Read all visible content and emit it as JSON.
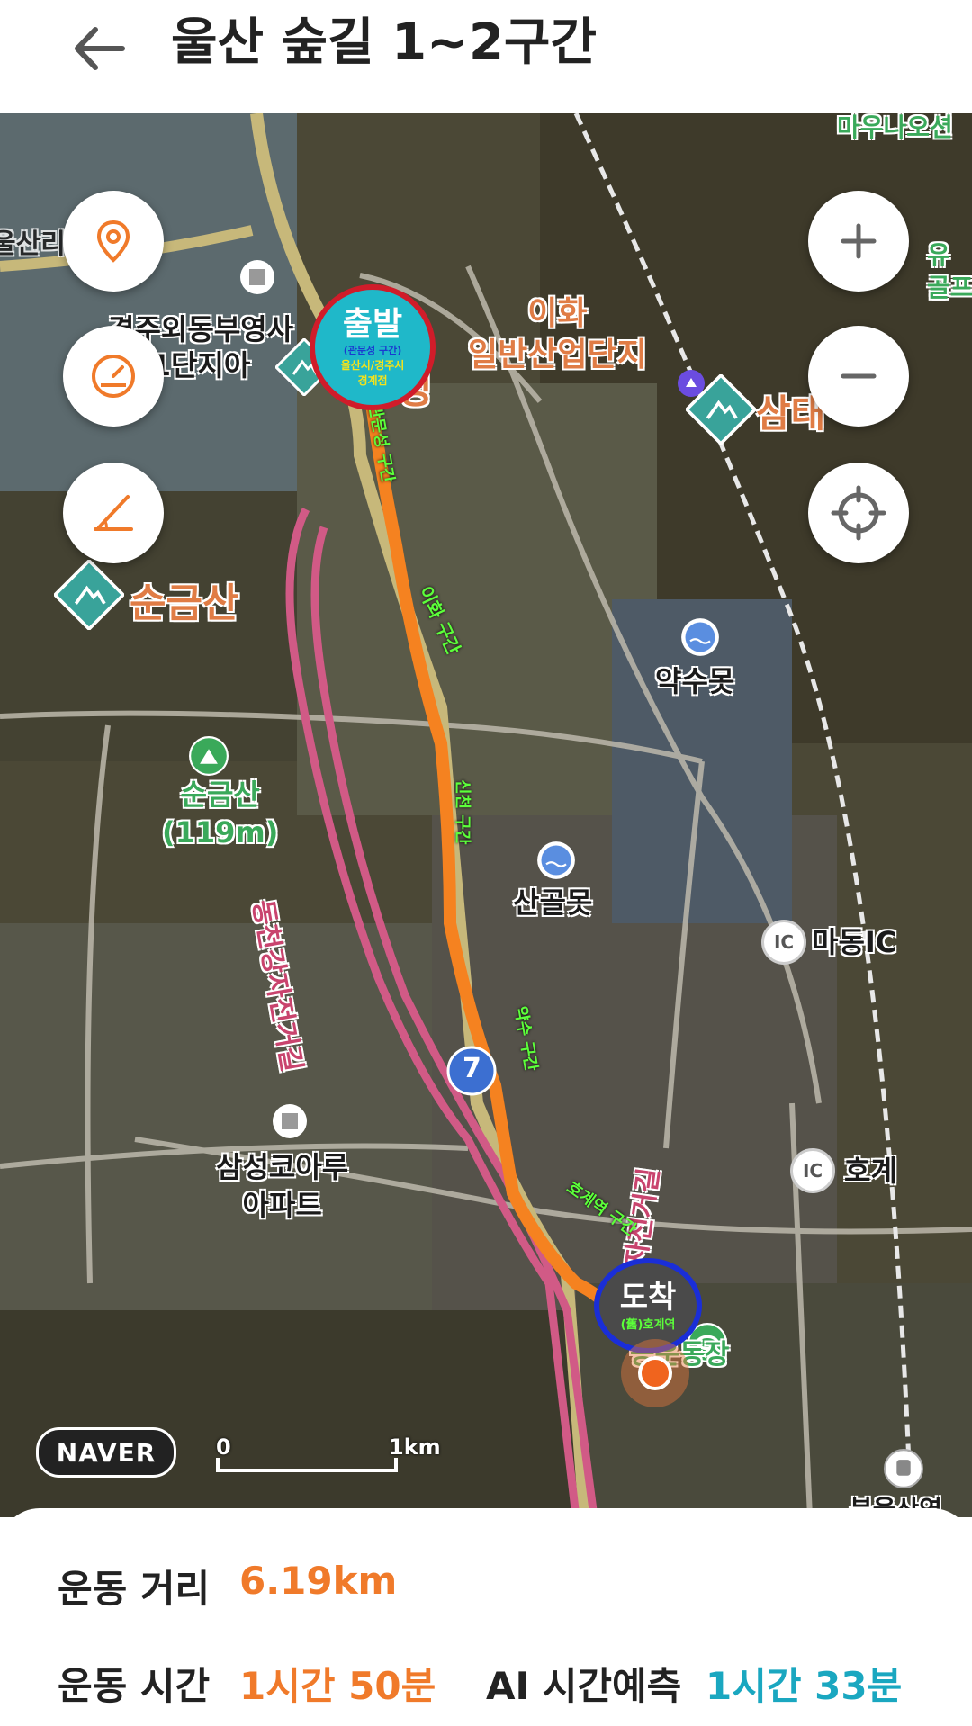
{
  "header": {
    "title": "울산 숲길 1~2구간"
  },
  "map": {
    "places": {
      "gyeongju_apt": "경주외동부영사\n1단지아",
      "ihwa_industrial": "이화\n일반산업단지",
      "samtae": "삼태",
      "sungeumsan": "순금산",
      "sungeumsan_peak": "순금산\n(119m)",
      "yaksumot": "약수못",
      "sangolmot": "산골못",
      "madong_ic": "마동IC",
      "hogye": "호계",
      "samsung_apt": "삼성코아루\n아파트",
      "sports_ground": "공운동장",
      "bike_road_1": "동천강자전거길",
      "bike_road_2": "동천강자전거길",
      "top_right": "마우나오션",
      "right_edge": "유\n골프",
      "left_edge": "울산리",
      "bottom_right": "북울산역",
      "frag_seong": "성",
      "route_7": "7",
      "ic_label": "IC"
    },
    "start_marker": {
      "title": "출발",
      "sub1": "(관문성 구간)",
      "sub2": "울산시/경주시",
      "sub3": "경계점"
    },
    "end_marker": {
      "title": "도착",
      "sub": "(舊)호계역"
    },
    "segments": {
      "seg1": "관문성 구간",
      "seg2": "이화 구간",
      "seg3": "신천 구간",
      "seg4": "약수 구간",
      "seg5": "호계역 구간"
    },
    "scale": {
      "zero": "0",
      "km": "1km"
    },
    "logo": "NAVER"
  },
  "stats": {
    "distance_label": "운동 거리",
    "distance_value": "6.19km",
    "time_label": "운동 시간",
    "time_value": "1시간 50분",
    "ai_label": "AI 시간예측",
    "ai_value": "1시간 33분"
  },
  "colors": {
    "accent": "#f07a2a",
    "ai": "#1aa7c0",
    "route": "#f58220"
  }
}
